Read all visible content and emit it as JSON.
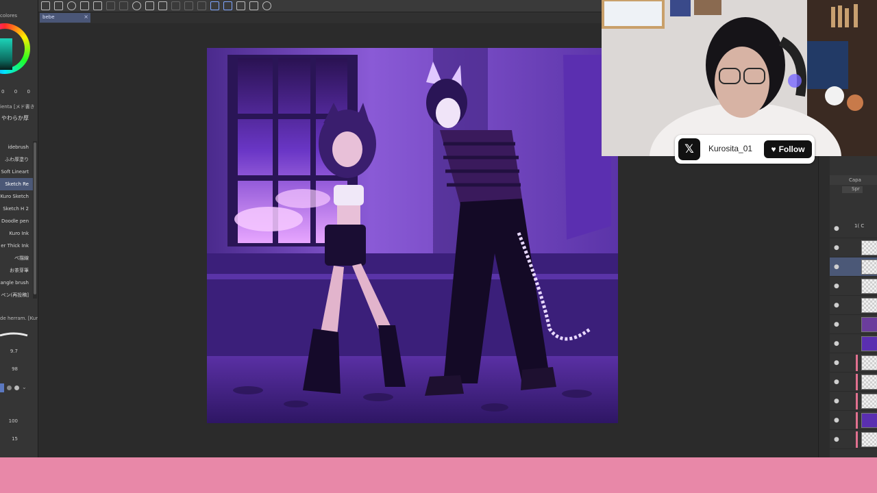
{
  "toolbar": {
    "icons": [
      "menu-icon",
      "pen-icon",
      "eye-icon",
      "copy-icon",
      "layer-icon",
      "undo-icon",
      "redo-icon",
      "spinner-icon",
      "fill-icon",
      "crop-icon",
      "transform-icon",
      "select-icon",
      "ruler-icon",
      "pen-pressure-icon",
      "line-icon",
      "edit-icon",
      "mobile-icon",
      "tools-icon"
    ]
  },
  "document_tab": {
    "label": "bebe",
    "close": "×"
  },
  "color_panel": {
    "title": "colores",
    "rgb": [
      "0",
      "0",
      "0"
    ]
  },
  "brush_panel": {
    "header": "ienta [メド書き",
    "category": "やわらか厚",
    "subtools": [
      "idebrush",
      "ふわ厚塗り",
      "Soft Lineart",
      "Sketch Re",
      "Kuro Sketch",
      "Sketch H 2",
      "Doodle pen",
      "Kuro Ink",
      "er Thick Ink",
      "ぺ描線",
      "お茶芽筆",
      "angle brush",
      "ペン(再投稿]"
    ],
    "selected_index": 3
  },
  "tool_property": {
    "title": "de herram. [Kur",
    "size": "9.7",
    "opacity": "98",
    "density": "100",
    "stabilization": "15"
  },
  "layer_panel": {
    "title": "Capa",
    "blend": "Spr",
    "folder_label": "1( C",
    "rows": 12
  },
  "stream_overlay": {
    "handle": "Kurosita_01",
    "follow_label": "Follow",
    "platform_icon": "x-logo-icon"
  },
  "colors": {
    "accent_bar": "#e888a8",
    "selection": "#4b5877",
    "art_purple": "#6a3fc0"
  }
}
